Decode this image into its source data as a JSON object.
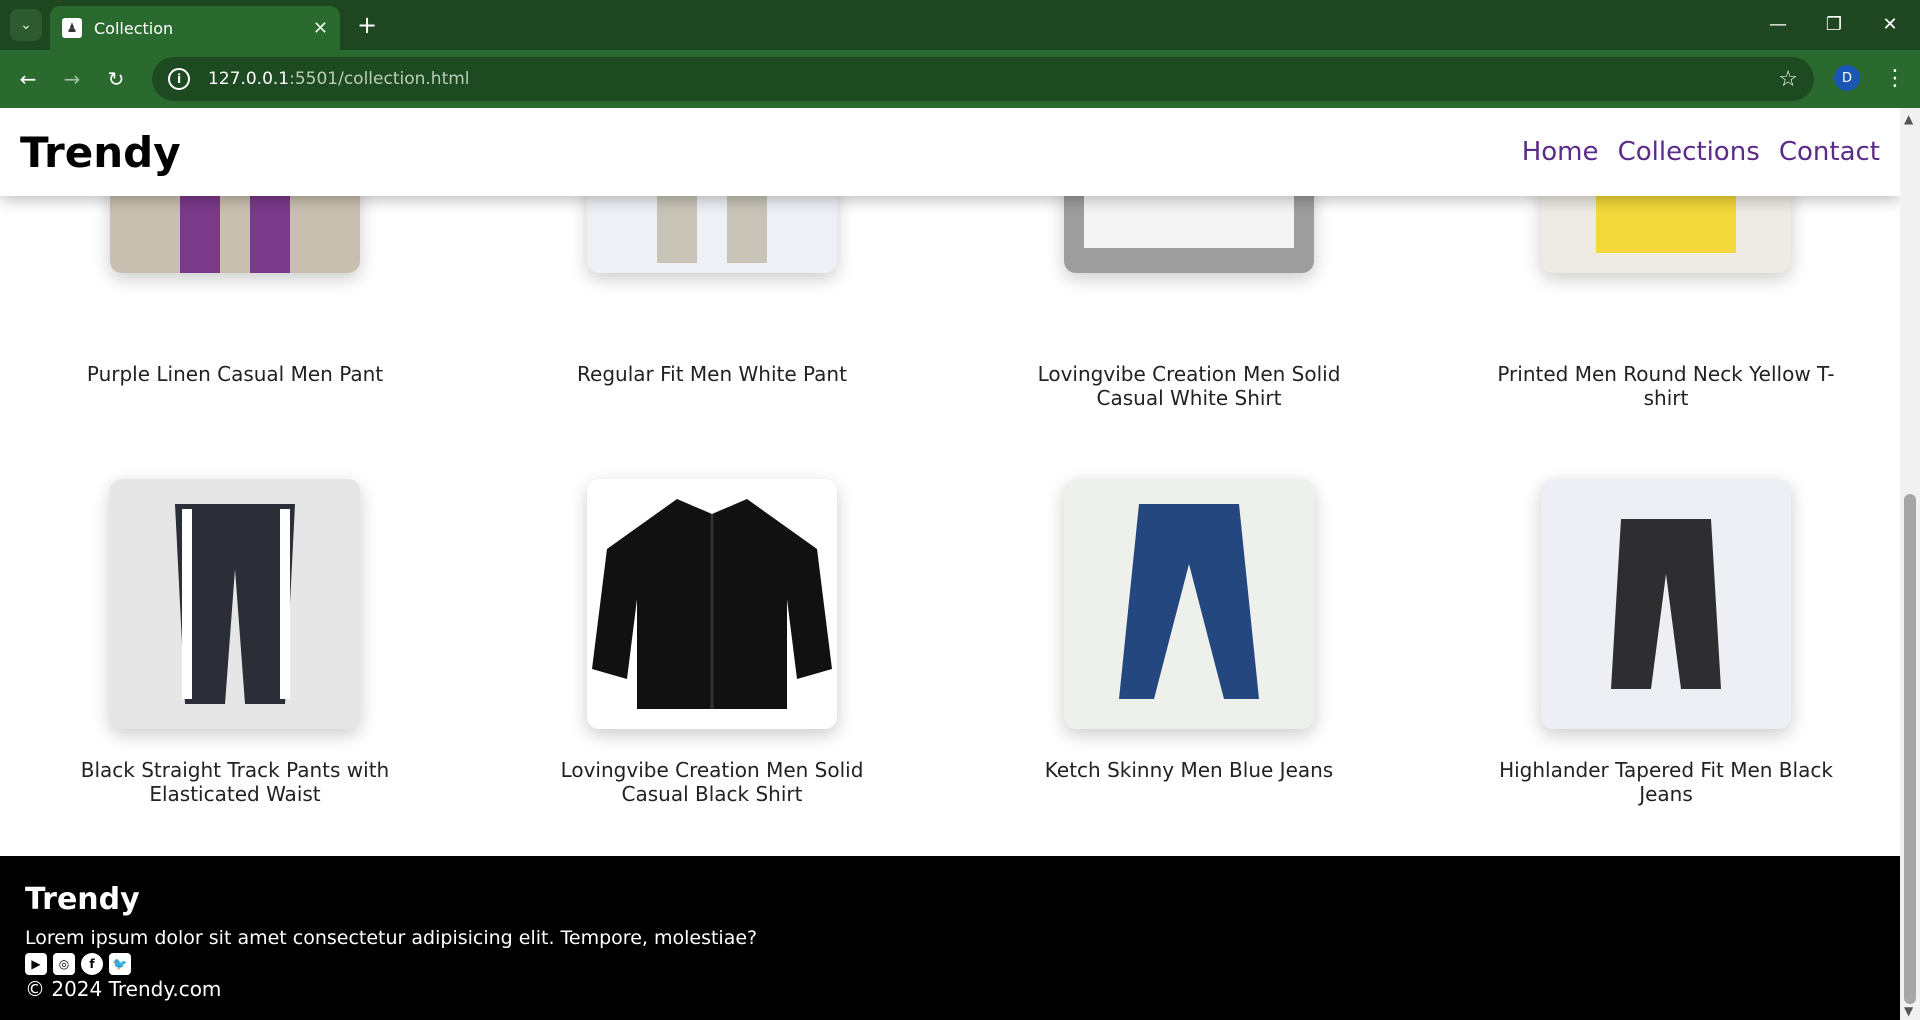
{
  "browser": {
    "tab_title": "Collection",
    "url_host": "127.0.0.1",
    "url_path": ":5501/collection.html",
    "profile_initial": "D"
  },
  "site": {
    "brand": "Trendy",
    "nav": [
      "Home",
      "Collections",
      "Contact"
    ]
  },
  "products": [
    {
      "name": "Purple Linen Casual Men Pant",
      "bg": "#c9bfb0",
      "icon": "purple-pant-icon"
    },
    {
      "name": "Regular Fit Men White Pant",
      "bg": "#eef0f5",
      "icon": "white-pant-icon"
    },
    {
      "name": "Lovingvibe Creation Men Solid Casual White Shirt",
      "bg": "#9e9e9e",
      "icon": "white-shirt-icon"
    },
    {
      "name": "Printed Men Round Neck Yellow T-shirt",
      "bg": "#eeeae4",
      "icon": "yellow-tshirt-icon"
    },
    {
      "name": "Black Straight Track Pants with Elasticated Waist",
      "bg": "#e6e6e6",
      "icon": "track-pants-icon"
    },
    {
      "name": "Lovingvibe Creation Men Solid Casual Black Shirt",
      "bg": "#ffffff",
      "icon": "black-shirt-icon"
    },
    {
      "name": "Ketch Skinny Men Blue Jeans",
      "bg": "#eef0ec",
      "icon": "blue-jeans-icon"
    },
    {
      "name": "Highlander Tapered Fit Men Black Jeans",
      "bg": "#eeeff4",
      "icon": "black-jeans-icon"
    }
  ],
  "footer": {
    "title": "Trendy",
    "description": "Lorem ipsum dolor sit amet consectetur adipisicing elit. Tempore, molestiae?",
    "social_icons": [
      "youtube-icon",
      "instagram-icon",
      "facebook-icon",
      "twitter-icon"
    ],
    "copyright": "© 2024 Trendy.com"
  }
}
